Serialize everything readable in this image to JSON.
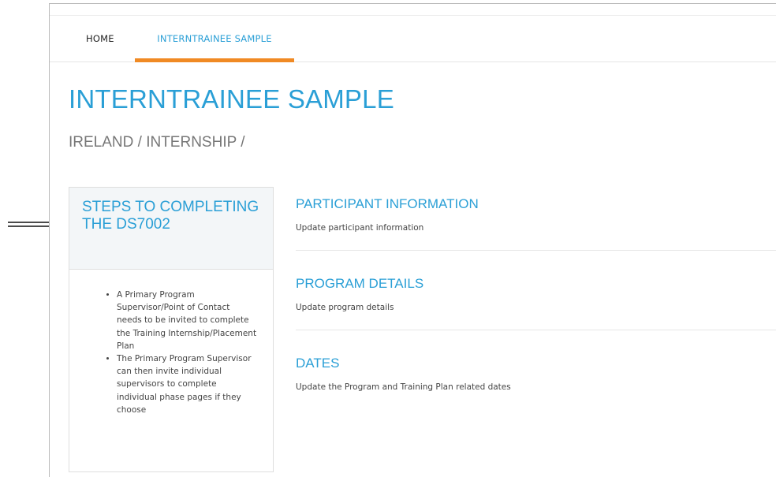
{
  "nav": {
    "items": [
      {
        "label": "HOME"
      },
      {
        "label": "INTERNTRAINEE SAMPLE",
        "active": true
      }
    ],
    "accent_color": "#f08a24"
  },
  "page": {
    "title": "INTERNTRAINEE SAMPLE",
    "breadcrumb": [
      "IRELAND",
      "INTERNSHIP"
    ],
    "title_color": "#2a9fd6"
  },
  "steps": {
    "title": "STEPS TO COMPLETING THE DS7002",
    "items": [
      "A Primary Program Supervisor/Point of Contact needs to be invited to complete the Training Internship/Placement Plan",
      "The Primary Program Supervisor can then invite individual supervisors to complete individual phase pages if they choose"
    ]
  },
  "sections": [
    {
      "title": "PARTICIPANT INFORMATION",
      "description": "Update participant information"
    },
    {
      "title": "PROGRAM DETAILS",
      "description": "Update program details"
    },
    {
      "title": "DATES",
      "description": "Update the Program and Training Plan related dates"
    }
  ],
  "annotation": {
    "icon": "hand-drawn-arrow-icon"
  }
}
